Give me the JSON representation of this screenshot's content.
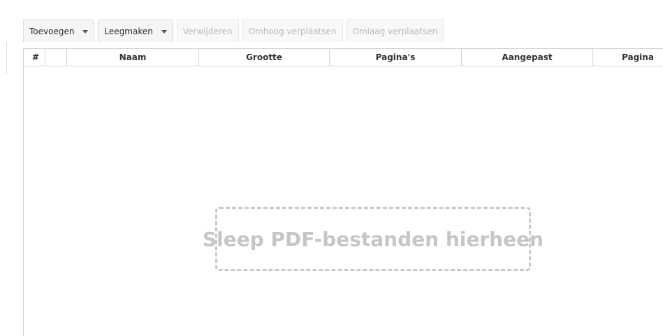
{
  "toolbar": {
    "add_label": "Toevoegen",
    "clear_label": "Leegmaken",
    "remove_label": "Verwijderen",
    "move_up_label": "Omhoog verplaatsen",
    "move_down_label": "Omlaag verplaatsen"
  },
  "table": {
    "columns": [
      "#",
      "",
      "Naam",
      "Grootte",
      "Pagina's",
      "Aangepast",
      "Pagina"
    ]
  },
  "dropzone": {
    "text": "Sleep PDF-bestanden hierheen"
  }
}
